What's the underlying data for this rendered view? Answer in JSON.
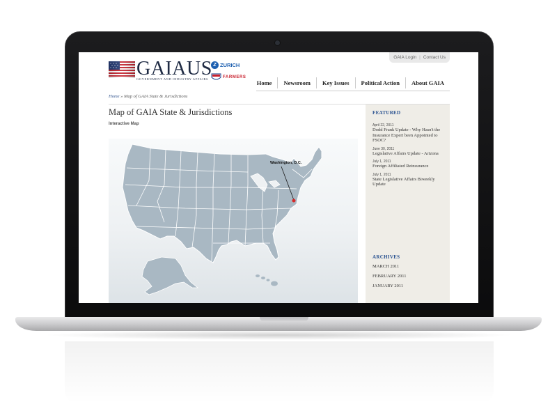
{
  "site": {
    "logo_word": "GAIAUS",
    "logo_tagline": "Government and Industry Affairs",
    "partner_1": "ZURICH",
    "partner_2": "FARMERS"
  },
  "utility_links": [
    "GAIA Login",
    "Contact Us"
  ],
  "nav": [
    "Home",
    "Newsroom",
    "Key Issues",
    "Political Action",
    "About GAIA"
  ],
  "breadcrumb": {
    "home": "Home",
    "separator": "»",
    "current": "Map of GAIA State & Jurisdictions"
  },
  "content": {
    "title": "Map of GAIA State & Jurisdictions",
    "subtitle": "Interactive Map",
    "map_marker_label": "Washington, D.C."
  },
  "sidebar": {
    "featured_heading": "FEATURED",
    "featured": [
      {
        "date": "April 22, 2011",
        "title": "Dodd Frank Update - Why Hasn't the Insurance Expert been Appointed to FSOC?"
      },
      {
        "date": "June 30, 2011",
        "title": "Legislative Affairs Update - Arizona"
      },
      {
        "date": "July 1, 2011",
        "title": "Foreign Affiliated Reinsurance"
      },
      {
        "date": "July 1, 2011",
        "title": "State Legislative Affairs Biweekly Update"
      }
    ],
    "archives_heading": "ARCHIVES",
    "archives": [
      "MARCH 2011",
      "FEBRUARY 2011",
      "JANUARY 2011"
    ]
  },
  "colors": {
    "brand_navy": "#1f2b44",
    "link_blue": "#27508f",
    "map_fill": "#a9b8c3",
    "sidebar_bg": "#efede7",
    "marker_red": "#d62a2a"
  }
}
